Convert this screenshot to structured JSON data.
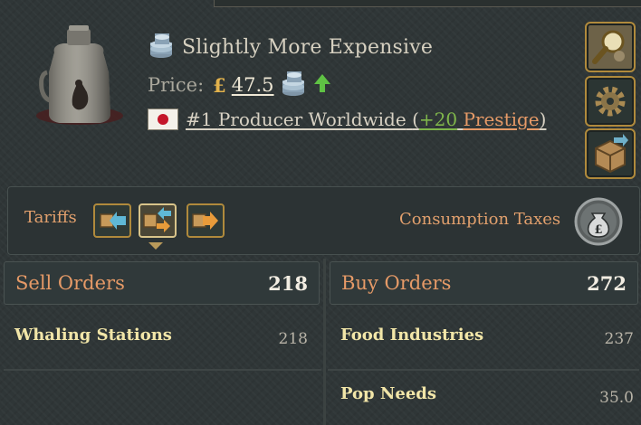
{
  "header": {
    "title": "Slightly More Expensive",
    "price_label": "Price:",
    "price_currency": "£",
    "price_value": "47.5",
    "producer": {
      "rank": "#1",
      "label": "Producer Worldwide",
      "open_paren": "(",
      "prestige_value": "+20",
      "prestige_label": "Prestige",
      "close_paren": ")"
    }
  },
  "side_buttons": [
    "magnifier-icon",
    "gear-icon",
    "crate-icon"
  ],
  "tariffs": {
    "label": "Tariffs",
    "buttons": [
      "tariff-import-icon",
      "tariff-both-icon",
      "tariff-export-icon"
    ],
    "selected": 1
  },
  "consumption_taxes": {
    "label": "Consumption Taxes"
  },
  "sell_orders": {
    "label": "Sell Orders",
    "total": "218",
    "rows": [
      {
        "name": "Whaling Stations",
        "value": "218"
      }
    ]
  },
  "buy_orders": {
    "label": "Buy Orders",
    "total": "272",
    "rows": [
      {
        "name": "Food Industries",
        "value": "237"
      },
      {
        "name": "Pop Needs",
        "value": "35.0"
      }
    ]
  },
  "colors": {
    "accent_orange": "#e69a67",
    "prestige_green": "#7fb64b",
    "gold_border": "#b08a3c",
    "flag_red": "#c4162a"
  }
}
